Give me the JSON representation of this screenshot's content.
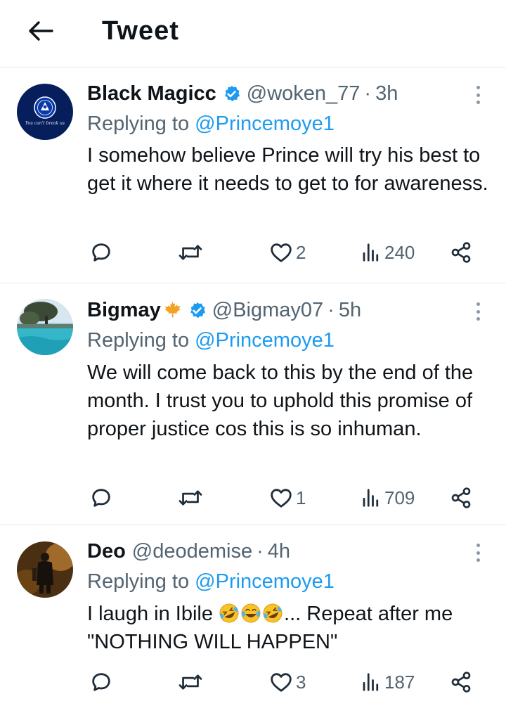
{
  "header": {
    "title": "Tweet"
  },
  "tweets": [
    {
      "name": "Black Magicc",
      "verified": true,
      "handle": "@woken_77",
      "time": "3h",
      "replying_label": "Replying to",
      "replying_to": "@Princemoye1",
      "text": "I somehow believe Prince will try his best to get it where it needs to get to for awareness.",
      "likes": "2",
      "views": "240",
      "avatar_text": "You can't break us"
    },
    {
      "name": "Bigmay",
      "verified": true,
      "handle": "@Bigmay07",
      "time": "5h",
      "replying_label": "Replying to",
      "replying_to": "@Princemoye1",
      "text": "We will come back to this by the end of the month.  I trust you to uphold this promise of proper justice cos this is so inhuman.",
      "likes": "1",
      "views": "709"
    },
    {
      "name": "Deo",
      "verified": false,
      "handle": "@deodemise",
      "time": "4h",
      "replying_label": "Replying to",
      "replying_to": "@Princemoye1",
      "text_before": "I laugh in Ibile",
      "text_after": "... Repeat after me \"NOTHING WILL HAPPEN\"",
      "likes": "3",
      "views": "187"
    }
  ],
  "colors": {
    "link": "#1d9bf0",
    "secondary": "#536471",
    "verified": "#1d9bf0",
    "divider": "#e6e9ec"
  },
  "icons": [
    "back-arrow-icon",
    "verified-badge-icon",
    "maple-leaf-icon",
    "more-vertical-icon",
    "reply-icon",
    "retweet-icon",
    "like-icon",
    "views-icon",
    "share-icon"
  ]
}
